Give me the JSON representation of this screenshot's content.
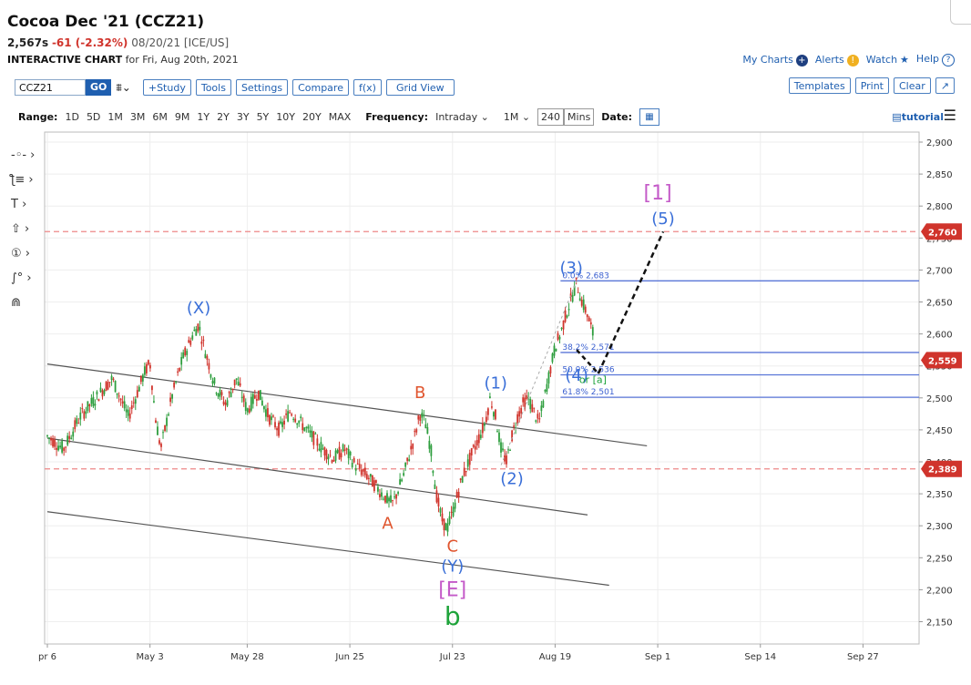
{
  "header": {
    "title": "Cocoa Dec '21 (CCZ21)",
    "last": "2,567s",
    "change": "-61 (-2.32%)",
    "meta": "08/20/21 [ICE/US]",
    "interactive_label": "INTERACTIVE CHART",
    "interactive_rest": "for Fri, Aug 20th, 2021"
  },
  "toplinks": {
    "my_charts": "My Charts",
    "alerts": "Alerts",
    "watch": "Watch",
    "help": "Help"
  },
  "toolbar": {
    "symbol": "CCZ21",
    "go": "GO",
    "draw": "⩩⌄",
    "study": "+Study",
    "tools": "Tools",
    "settings": "Settings",
    "compare": "Compare",
    "fx": "f(x)",
    "grid": "Grid View",
    "templates": "Templates",
    "print": "Print",
    "clear": "Clear",
    "expand": "↗"
  },
  "rangebar": {
    "range_label": "Range:",
    "ranges": [
      "1D",
      "5D",
      "1M",
      "3M",
      "6M",
      "9M",
      "1Y",
      "2Y",
      "3Y",
      "5Y",
      "10Y",
      "20Y",
      "MAX"
    ],
    "frequency_label": "Frequency:",
    "frequency": "Intraday",
    "interval": "1M",
    "minutes": "240",
    "mins": "Mins",
    "date_label": "Date:",
    "tutorial": "tutorial"
  },
  "colors": {
    "up": "#2e9e3e",
    "down": "#d0342c",
    "blue": "#3a6fd8",
    "purple": "#c45ac8",
    "red_label": "#e0552e",
    "green_label": "#1ea33a"
  },
  "chart_data": {
    "type": "candlestick",
    "ylim": [
      2120,
      2910
    ],
    "y_ticks": [
      2900,
      2850,
      2800,
      2750,
      2700,
      2650,
      2600,
      2550,
      2500,
      2450,
      2400,
      2350,
      2300,
      2250,
      2200,
      2150
    ],
    "x_labels": [
      "pr 6",
      "May 3",
      "May 28",
      "Jun 25",
      "Jul 23",
      "Aug 19",
      "Sep 1",
      "Sep 14",
      "Sep 27"
    ],
    "x_label_index": [
      0,
      19,
      37,
      56,
      75,
      94,
      113,
      132,
      151
    ],
    "price_path": [
      [
        0,
        2440
      ],
      [
        3,
        2420
      ],
      [
        6,
        2470
      ],
      [
        9,
        2500
      ],
      [
        12,
        2530
      ],
      [
        15,
        2470
      ],
      [
        18,
        2540
      ],
      [
        19,
        2555
      ],
      [
        20,
        2470
      ],
      [
        21,
        2420
      ],
      [
        23,
        2500
      ],
      [
        25,
        2560
      ],
      [
        27,
        2600
      ],
      [
        28,
        2615
      ],
      [
        29,
        2580
      ],
      [
        31,
        2520
      ],
      [
        33,
        2490
      ],
      [
        35,
        2530
      ],
      [
        37,
        2480
      ],
      [
        39,
        2510
      ],
      [
        41,
        2470
      ],
      [
        43,
        2450
      ],
      [
        45,
        2480
      ],
      [
        47,
        2460
      ],
      [
        49,
        2440
      ],
      [
        51,
        2420
      ],
      [
        53,
        2405
      ],
      [
        55,
        2420
      ],
      [
        57,
        2395
      ],
      [
        59,
        2380
      ],
      [
        61,
        2360
      ],
      [
        63,
        2340
      ],
      [
        64,
        2335
      ],
      [
        66,
        2380
      ],
      [
        68,
        2440
      ],
      [
        69,
        2475
      ],
      [
        70,
        2460
      ],
      [
        71,
        2420
      ],
      [
        72,
        2350
      ],
      [
        73,
        2310
      ],
      [
        74,
        2295
      ],
      [
        75,
        2320
      ],
      [
        77,
        2380
      ],
      [
        79,
        2420
      ],
      [
        81,
        2460
      ],
      [
        82,
        2500
      ],
      [
        83,
        2470
      ],
      [
        84,
        2420
      ],
      [
        85,
        2400
      ],
      [
        86,
        2440
      ],
      [
        87,
        2470
      ],
      [
        88,
        2490
      ],
      [
        89,
        2500
      ],
      [
        90,
        2480
      ],
      [
        91,
        2460
      ],
      [
        92,
        2500
      ],
      [
        93,
        2540
      ],
      [
        94,
        2580
      ],
      [
        95,
        2600
      ],
      [
        96,
        2630
      ],
      [
        97,
        2655
      ],
      [
        98,
        2680
      ],
      [
        99,
        2650
      ],
      [
        100,
        2630
      ],
      [
        101,
        2600
      ]
    ],
    "horizontal_lines": [
      {
        "price": 2760,
        "style": "dashed-red",
        "tag": "2,760"
      },
      {
        "price": 2389,
        "style": "dashed-red",
        "tag": "2,389"
      },
      {
        "price": 2683,
        "style": "fib",
        "label": "0.0% 2,683"
      },
      {
        "price": 2571,
        "style": "fib",
        "label": "38.2% 2,571"
      },
      {
        "price": 2536,
        "style": "fib",
        "label": "50.0% 2,536"
      },
      {
        "price": 2501,
        "style": "fib",
        "label": "61.8% 2,501"
      }
    ],
    "current_price_tag": "2,559",
    "current_price": 2559,
    "channel_lines": [
      {
        "from": [
          0,
          2553
        ],
        "to": [
          111,
          2425
        ]
      },
      {
        "from": [
          0,
          2437
        ],
        "to": [
          100,
          2317
        ]
      },
      {
        "from": [
          0,
          2322
        ],
        "to": [
          104,
          2207
        ]
      }
    ],
    "projection": {
      "from": [
        102,
        2538
      ],
      "to": [
        114,
        2760
      ]
    },
    "wave_labels": [
      {
        "text": "(X)",
        "i": 28,
        "p": 2632,
        "color": "blue"
      },
      {
        "text": "A",
        "i": 63,
        "p": 2295,
        "color": "red"
      },
      {
        "text": "B",
        "i": 69,
        "p": 2500,
        "color": "red"
      },
      {
        "text": "C",
        "i": 75,
        "p": 2260,
        "color": "red"
      },
      {
        "text": "(Y)",
        "i": 75,
        "p": 2228,
        "color": "blue"
      },
      {
        "text": "[E]",
        "i": 75,
        "p": 2190,
        "color": "purple"
      },
      {
        "text": "b",
        "i": 75,
        "p": 2145,
        "color": "green"
      },
      {
        "text": "(1)",
        "i": 83,
        "p": 2515,
        "color": "blue"
      },
      {
        "text": "(2)",
        "i": 86,
        "p": 2365,
        "color": "blue"
      },
      {
        "text": "(3)",
        "i": 97,
        "p": 2695,
        "color": "blue"
      },
      {
        "text": "(4)",
        "i": 98,
        "p": 2527,
        "color": "blue"
      },
      {
        "text": "or [a]",
        "i": 101,
        "p": 2523,
        "color": "green"
      },
      {
        "text": "(5)",
        "i": 114,
        "p": 2772,
        "color": "blue"
      },
      {
        "text": "[1]",
        "i": 113,
        "p": 2810,
        "color": "purple"
      }
    ]
  }
}
